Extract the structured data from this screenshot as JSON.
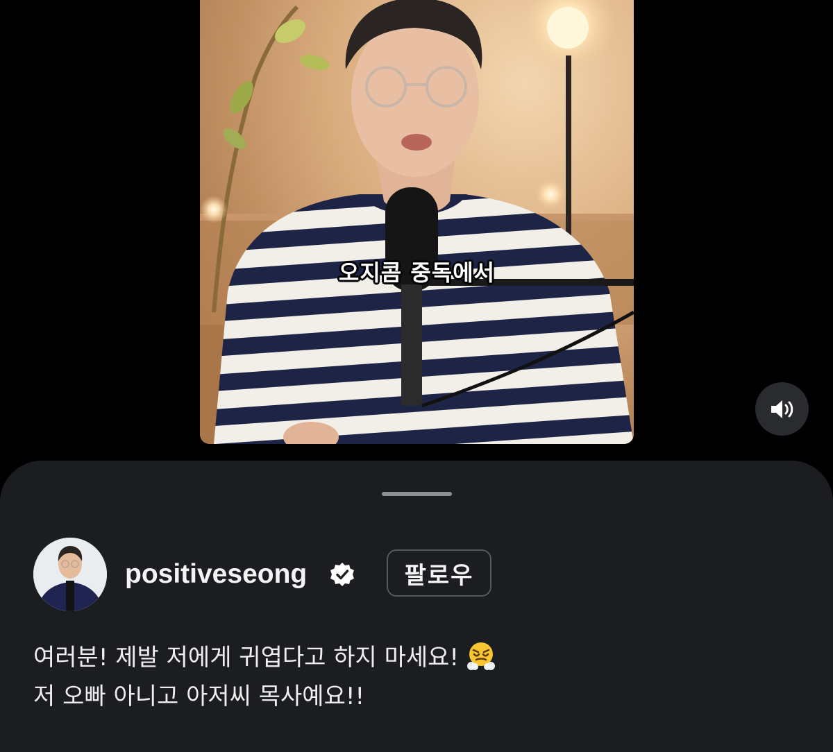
{
  "video": {
    "subtitle": "오지콤 중독에서"
  },
  "controls": {
    "mute_icon": "speaker-on-icon"
  },
  "post": {
    "username": "positiveseong",
    "verified_icon": "verified-badge-icon",
    "follow_label": "팔로우",
    "caption_line1": "여러분! 제발 저에게 귀엽다고 하지 마세요!",
    "caption_emoji": "face-with-steam-icon",
    "caption_line2": "저 오빠 아니고 아저씨 목사예요!!"
  },
  "colors": {
    "sheet_background": "#1b1d21",
    "page_background": "#000000",
    "follow_border": "#55585e",
    "verified_badge": "#ffffff"
  }
}
